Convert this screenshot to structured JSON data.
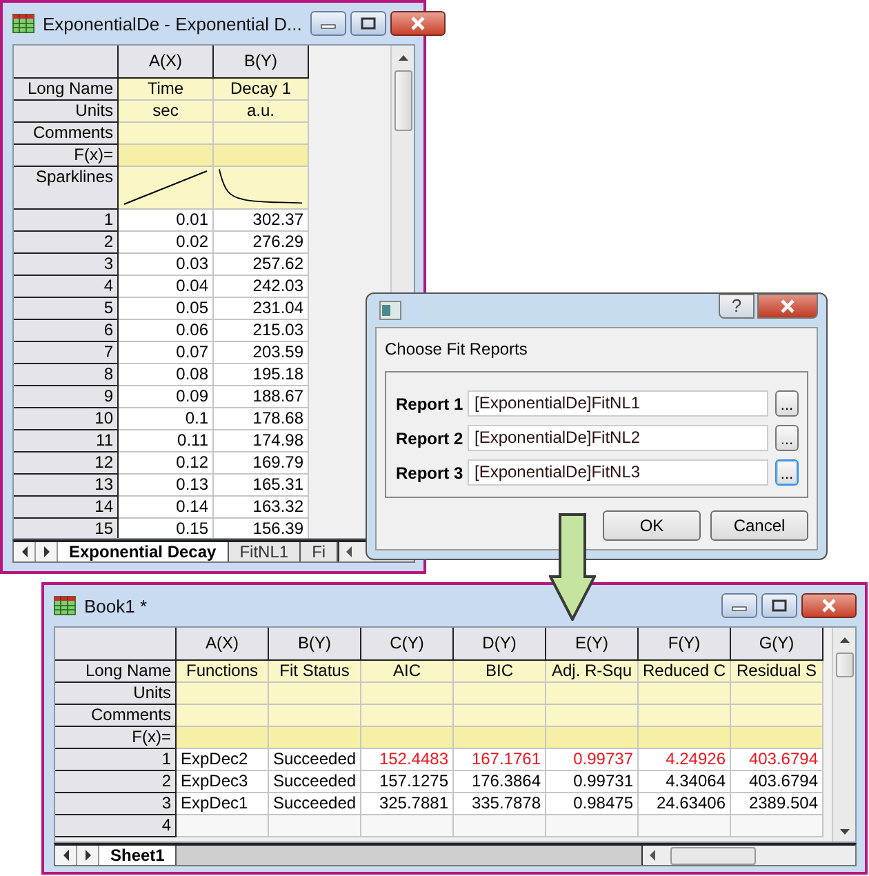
{
  "worksheet_window": {
    "title": "ExponentialDe - Exponential D...",
    "columns": [
      {
        "header": "A(X)",
        "long_name": "Time",
        "units": "sec",
        "kind": "number",
        "sparkline": {
          "kind": "rising"
        }
      },
      {
        "header": "B(Y)",
        "long_name": "Decay 1",
        "units": "a.u.",
        "kind": "number",
        "sparkline": {
          "kind": "decay"
        }
      }
    ],
    "label_rows": [
      {
        "label": "Long Name",
        "kind": "long_name"
      },
      {
        "label": "Units",
        "kind": "units"
      },
      {
        "label": "Comments",
        "kind": "comments"
      },
      {
        "label": "F(x)=",
        "kind": "formula"
      },
      {
        "label": "Sparklines",
        "kind": "sparklines"
      }
    ],
    "rows": [
      {
        "index": "1",
        "cells": [
          "0.01",
          "302.37"
        ]
      },
      {
        "index": "2",
        "cells": [
          "0.02",
          "276.29"
        ]
      },
      {
        "index": "3",
        "cells": [
          "0.03",
          "257.62"
        ]
      },
      {
        "index": "4",
        "cells": [
          "0.04",
          "242.03"
        ]
      },
      {
        "index": "5",
        "cells": [
          "0.05",
          "231.04"
        ]
      },
      {
        "index": "6",
        "cells": [
          "0.06",
          "215.03"
        ]
      },
      {
        "index": "7",
        "cells": [
          "0.07",
          "203.59"
        ]
      },
      {
        "index": "8",
        "cells": [
          "0.08",
          "195.18"
        ]
      },
      {
        "index": "9",
        "cells": [
          "0.09",
          "188.67"
        ]
      },
      {
        "index": "10",
        "cells": [
          "0.1",
          "178.68"
        ]
      },
      {
        "index": "11",
        "cells": [
          "0.11",
          "174.98"
        ]
      },
      {
        "index": "12",
        "cells": [
          "0.12",
          "169.79"
        ]
      },
      {
        "index": "13",
        "cells": [
          "0.13",
          "165.31"
        ]
      },
      {
        "index": "14",
        "cells": [
          "0.14",
          "163.32"
        ]
      },
      {
        "index": "15",
        "cells": [
          "0.15",
          "156.39"
        ]
      }
    ],
    "tabs": [
      {
        "label": "Exponential Decay",
        "selected": true
      },
      {
        "label": "FitNL1",
        "selected": false
      },
      {
        "label": "Fi",
        "selected": false
      }
    ]
  },
  "results_window": {
    "title": "Book1 *",
    "columns": [
      {
        "header": "A(X)",
        "long_name": "Functions",
        "kind": "text"
      },
      {
        "header": "B(Y)",
        "long_name": "Fit Status",
        "kind": "text"
      },
      {
        "header": "C(Y)",
        "long_name": "AIC",
        "kind": "number"
      },
      {
        "header": "D(Y)",
        "long_name": "BIC",
        "kind": "number"
      },
      {
        "header": "E(Y)",
        "long_name": "Adj. R-Squ",
        "kind": "number"
      },
      {
        "header": "F(Y)",
        "long_name": "Reduced C",
        "kind": "number"
      },
      {
        "header": "G(Y)",
        "long_name": "Residual S",
        "kind": "number"
      }
    ],
    "label_rows": [
      {
        "label": "Long Name",
        "kind": "long_name"
      },
      {
        "label": "Units",
        "kind": "units"
      },
      {
        "label": "Comments",
        "kind": "comments"
      },
      {
        "label": "F(x)=",
        "kind": "formula"
      }
    ],
    "rows": [
      {
        "index": "1",
        "best": true,
        "cells": [
          "ExpDec2",
          "Succeeded",
          "152.4483",
          "167.1761",
          "0.99737",
          "4.24926",
          "403.6794"
        ]
      },
      {
        "index": "2",
        "best": false,
        "cells": [
          "ExpDec3",
          "Succeeded",
          "157.1275",
          "176.3864",
          "0.99731",
          "4.34064",
          "403.6794"
        ]
      },
      {
        "index": "3",
        "best": false,
        "cells": [
          "ExpDec1",
          "Succeeded",
          "325.7881",
          "335.7878",
          "0.98475",
          "24.63406",
          "2389.504"
        ]
      },
      {
        "index": "4"
      }
    ],
    "tabs": [
      {
        "label": "Sheet1",
        "selected": true
      }
    ]
  },
  "dialog": {
    "help": "?",
    "heading": "Choose Fit Reports",
    "reports": [
      {
        "label": "Report 1",
        "value": "[ExponentialDe]FitNL1",
        "button": "...",
        "focused": false
      },
      {
        "label": "Report 2",
        "value": "[ExponentialDe]FitNL2",
        "button": "...",
        "focused": false
      },
      {
        "label": "Report 3",
        "value": "[ExponentialDe]FitNL3",
        "button": "...",
        "focused": true
      }
    ],
    "buttons": [
      "OK",
      "Cancel"
    ]
  }
}
